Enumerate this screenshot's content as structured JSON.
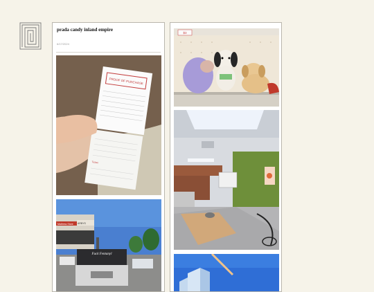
{
  "post": {
    "title": "prada candy inland empire",
    "date": "6/17/2024"
  },
  "photo1": {
    "card_title": "PROOF OF PURCHASE",
    "card_sub": "Ticket"
  },
  "photo2": {
    "tag": "$3"
  },
  "photo3": {
    "truck_text": "Fuck Fentanyl",
    "sign_left": "Mattress Store",
    "sign_right": "ARBYS"
  },
  "icons": {
    "logo": "square-spiral-logo-icon"
  }
}
